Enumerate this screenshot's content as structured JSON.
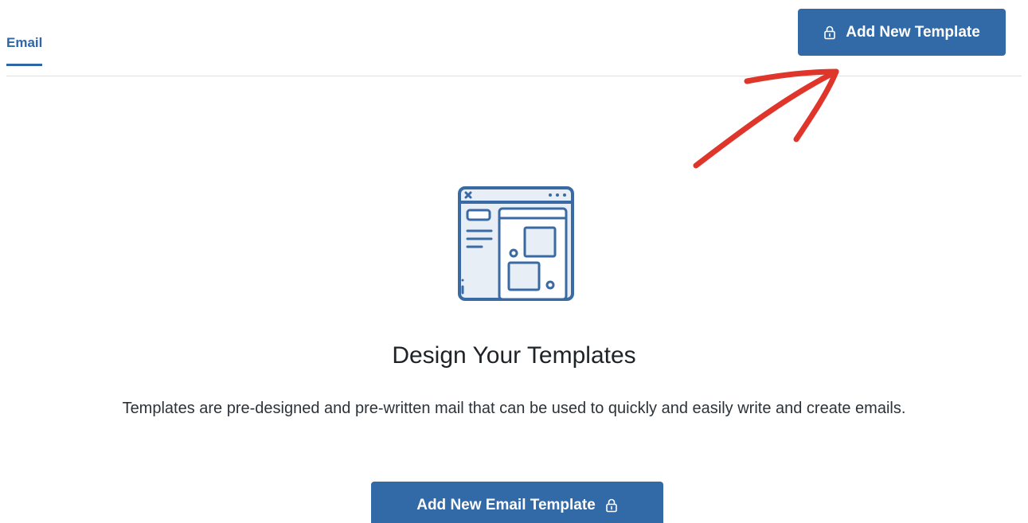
{
  "tabs": [
    {
      "label": "Email",
      "active": true
    }
  ],
  "header": {
    "add_template_label": "Add New Template",
    "add_template_icon": "lock-icon"
  },
  "empty_state": {
    "illustration_icon": "browser-window-template-icon",
    "title": "Design Your Templates",
    "description": "Templates are pre-designed and pre-written mail that can be used to quickly and easily write and create emails.",
    "cta_label": "Add New Email Template",
    "cta_icon": "lock-icon"
  },
  "annotation": {
    "arrow_icon": "red-arrow-icon",
    "arrow_color": "#e0352b"
  },
  "colors": {
    "accent": "#326aa8",
    "tab_active": "#2f66a6",
    "illustration_stroke": "#3a6aa3",
    "illustration_fill": "#e8eef6"
  }
}
